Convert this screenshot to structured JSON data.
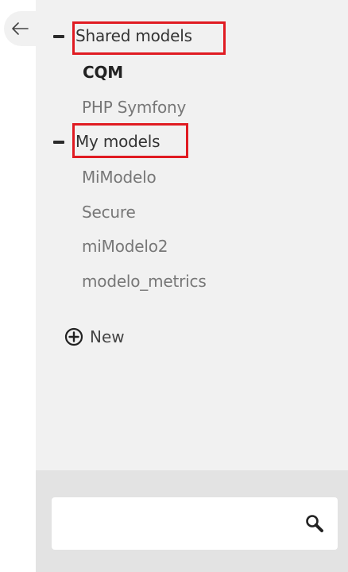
{
  "navigation": {
    "back_icon": "arrow-left-icon"
  },
  "groups": [
    {
      "label": "Shared models",
      "expanded": true,
      "toggle_icon": "minus-icon",
      "items": [
        {
          "label": "CQM",
          "active": true
        },
        {
          "label": "PHP Symfony",
          "active": false
        }
      ]
    },
    {
      "label": "My models",
      "expanded": true,
      "toggle_icon": "minus-icon",
      "items": [
        {
          "label": "MiModelo"
        },
        {
          "label": "Secure"
        },
        {
          "label": "miModelo2"
        },
        {
          "label": "modelo_metrics"
        }
      ]
    }
  ],
  "new_button": {
    "label": "New",
    "icon": "plus-circle-icon"
  },
  "search": {
    "value": "",
    "placeholder": "",
    "icon": "search-icon"
  },
  "colors": {
    "highlight": "#e01b22",
    "panel_bg": "#f1f1f1",
    "footer_bg": "#e3e3e3"
  }
}
